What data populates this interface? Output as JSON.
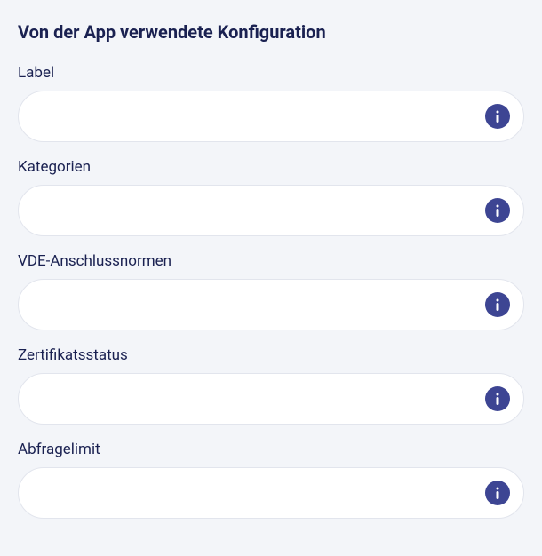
{
  "section": {
    "title": "Von der App verwendete Konfiguration"
  },
  "fields": [
    {
      "label": "Label",
      "value": ""
    },
    {
      "label": "Kategorien",
      "value": ""
    },
    {
      "label": "VDE-Anschlussnormen",
      "value": ""
    },
    {
      "label": "Zertifikatsstatus",
      "value": ""
    },
    {
      "label": "Abfragelimit",
      "value": ""
    }
  ]
}
